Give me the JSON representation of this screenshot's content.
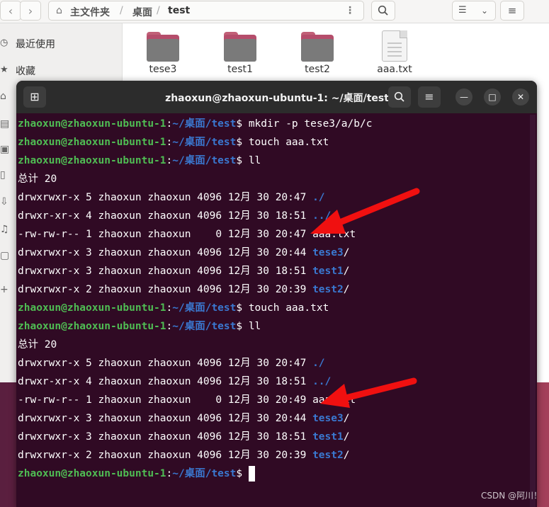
{
  "file_manager": {
    "breadcrumb": {
      "home": "主文件夹",
      "seg1": "桌面",
      "seg2": "test"
    },
    "sidebar": [
      {
        "label": "最近使用",
        "icon": "clock-icon"
      },
      {
        "label": "收藏",
        "icon": "star-icon"
      }
    ],
    "files": [
      {
        "name": "tese3",
        "type": "folder"
      },
      {
        "name": "test1",
        "type": "folder"
      },
      {
        "name": "test2",
        "type": "folder"
      },
      {
        "name": "aaa.txt",
        "type": "text-file"
      }
    ]
  },
  "terminal": {
    "title": "zhaoxun@zhaoxun-ubuntu-1: ~/桌面/test",
    "prompt_user": "zhaoxun@zhaoxun-ubuntu-1",
    "prompt_sep": ":",
    "prompt_path": "~/桌面/test",
    "prompt_end": "$",
    "commands": {
      "c1": " mkdir -p tese3/a/b/c",
      "c2": " touch aaa.txt",
      "c3": " ll",
      "c4": " touch aaa.txt",
      "c5": " ll",
      "c6": " "
    },
    "listing1": {
      "total": "总计 20",
      "r1": "drwxrwxr-x 5 zhaoxun zhaoxun 4096 12月 30 20:47 ",
      "r1n": "./",
      "r2": "drwxr-xr-x 4 zhaoxun zhaoxun 4096 12月 30 18:51 ",
      "r2n": "../",
      "r3": "-rw-rw-r-- 1 zhaoxun zhaoxun    0 12月 30 20:47 ",
      "r3n": "aaa.txt",
      "r4": "drwxrwxr-x 3 zhaoxun zhaoxun 4096 12月 30 20:44 ",
      "r4n": "tese3",
      "r4s": "/",
      "r5": "drwxrwxr-x 3 zhaoxun zhaoxun 4096 12月 30 18:51 ",
      "r5n": "test1",
      "r5s": "/",
      "r6": "drwxrwxr-x 2 zhaoxun zhaoxun 4096 12月 30 20:39 ",
      "r6n": "test2",
      "r6s": "/"
    },
    "listing2": {
      "total": "总计 20",
      "r1": "drwxrwxr-x 5 zhaoxun zhaoxun 4096 12月 30 20:47 ",
      "r1n": "./",
      "r2": "drwxr-xr-x 4 zhaoxun zhaoxun 4096 12月 30 18:51 ",
      "r2n": "../",
      "r3": "-rw-rw-r-- 1 zhaoxun zhaoxun    0 12月 30 20:49 ",
      "r3n": "aaa.txt",
      "r4": "drwxrwxr-x 3 zhaoxun zhaoxun 4096 12月 30 20:44 ",
      "r4n": "tese3",
      "r4s": "/",
      "r5": "drwxrwxr-x 3 zhaoxun zhaoxun 4096 12月 30 18:51 ",
      "r5n": "test1",
      "r5s": "/",
      "r6": "drwxrwxr-x 2 zhaoxun zhaoxun 4096 12月 30 20:39 ",
      "r6n": "test2",
      "r6s": "/"
    }
  },
  "annotation_color": "#f01010",
  "watermark": "CSDN @阿川！"
}
